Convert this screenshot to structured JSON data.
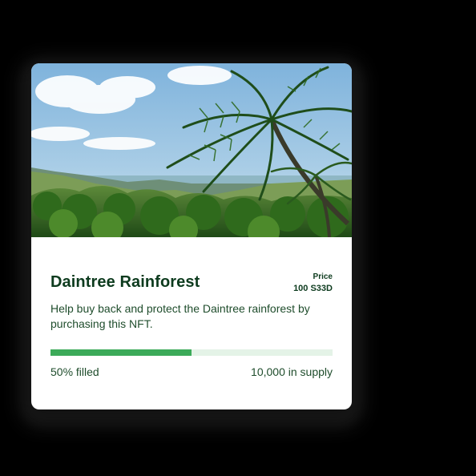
{
  "card": {
    "title": "Daintree Rainforest",
    "price_label": "Price",
    "price_value": "100 S33D",
    "description": "Help buy back and protect the Daintree rainforest by purchasing this NFT.",
    "progress_fraction": 0.5,
    "filled_label": "50% filled",
    "supply_label": "10,000 in supply"
  },
  "colors": {
    "title": "#0d3b1e",
    "text": "#1f4d2c",
    "progress_fill": "#3caa59",
    "progress_track": "#e4f3e7"
  }
}
